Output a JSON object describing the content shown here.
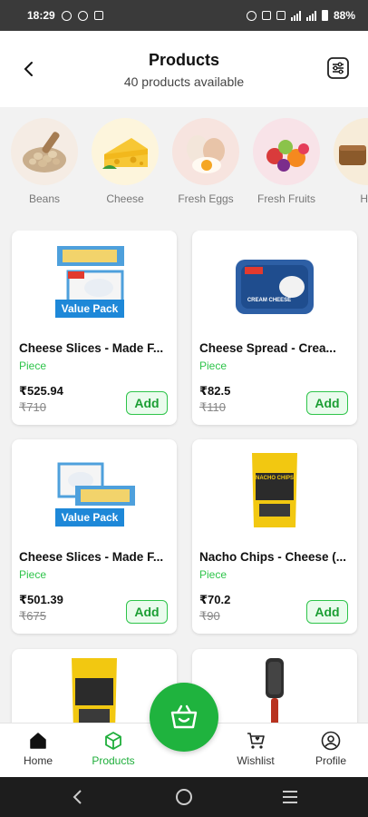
{
  "status_bar": {
    "time": "18:29",
    "battery": "88%"
  },
  "header": {
    "title": "Products",
    "subtitle": "40 products available"
  },
  "categories": [
    {
      "label": "Beans"
    },
    {
      "label": "Cheese"
    },
    {
      "label": "Fresh Eggs"
    },
    {
      "label": "Fresh Fruits"
    },
    {
      "label": "Ho"
    }
  ],
  "products": [
    {
      "name": "Cheese Slices - Made F...",
      "unit": "Piece",
      "price": "₹525.94",
      "mrp": "₹710",
      "badge": "Value Pack",
      "add_label": "Add"
    },
    {
      "name": "Cheese Spread - Crea...",
      "unit": "Piece",
      "price": "₹82.5",
      "mrp": "₹110",
      "package_text": "CREAM CHEESE",
      "add_label": "Add"
    },
    {
      "name": "Cheese Slices - Made F...",
      "unit": "Piece",
      "price": "₹501.39",
      "mrp": "₹675",
      "badge": "Value Pack",
      "add_label": "Add"
    },
    {
      "name": "Nacho Chips - Cheese (...",
      "unit": "Piece",
      "price": "₹70.2",
      "mrp": "₹90",
      "package_text": "NACHO CHIPS",
      "add_label": "Add"
    }
  ],
  "bottom_nav": [
    {
      "label": "Home",
      "icon": "home-icon"
    },
    {
      "label": "Products",
      "icon": "box-icon",
      "active": true
    },
    {
      "label": "Wishlist",
      "icon": "heart-cart-icon"
    },
    {
      "label": "Profile",
      "icon": "user-icon"
    }
  ],
  "fab": {
    "icon": "basket-icon"
  },
  "colors": {
    "accent": "#1fb33e",
    "unit_text": "#2ec44a",
    "status_bar": "#3a3a3a",
    "badge_blue": "#1e88d8"
  }
}
